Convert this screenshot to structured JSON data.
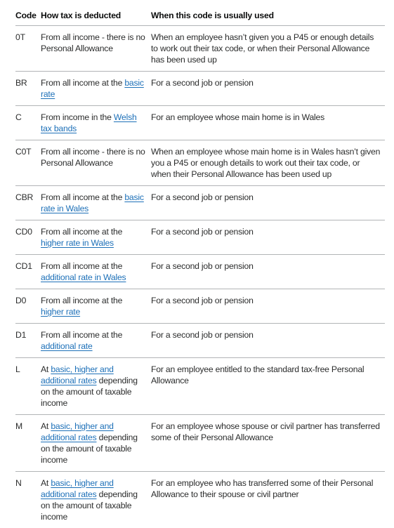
{
  "table": {
    "headers": [
      "Code",
      "How tax is deducted",
      "When this code is usually used"
    ],
    "link_color": "#1d70b8",
    "rows": [
      {
        "code": "0T",
        "how": [
          {
            "text": "From all income - there is no Personal Allowance"
          }
        ],
        "when": "When an employee hasn’t given you a P45 or enough details to work out their tax code, or when their Personal Allowance has been used up"
      },
      {
        "code": "BR",
        "how": [
          {
            "text": "From all income at the "
          },
          {
            "text": "basic rate",
            "link": true
          }
        ],
        "when": "For a second job or pension"
      },
      {
        "code": "C",
        "how": [
          {
            "text": "From income in the "
          },
          {
            "text": "Welsh tax bands",
            "link": true
          }
        ],
        "when": "For an employee whose main home is in Wales"
      },
      {
        "code": "C0T",
        "how": [
          {
            "text": "From all income - there is no Personal Allowance"
          }
        ],
        "when": "When an employee whose main home is in Wales hasn’t given you a P45 or enough details to work out their tax code, or when their Personal Allowance has been used up"
      },
      {
        "code": "CBR",
        "how": [
          {
            "text": "From all income at the "
          },
          {
            "text": "basic rate in Wales",
            "link": true
          }
        ],
        "when": "For a second job or pension"
      },
      {
        "code": "CD0",
        "how": [
          {
            "text": "From all income at the "
          },
          {
            "text": "higher rate in Wales",
            "link": true
          }
        ],
        "when": "For a second job or pension"
      },
      {
        "code": "CD1",
        "how": [
          {
            "text": "From all income at the "
          },
          {
            "text": "additional rate in Wales",
            "link": true
          }
        ],
        "when": "For a second job or pension"
      },
      {
        "code": "D0",
        "how": [
          {
            "text": "From all income at the "
          },
          {
            "text": "higher rate",
            "link": true
          }
        ],
        "when": "For a second job or pension"
      },
      {
        "code": "D1",
        "how": [
          {
            "text": "From all income at the "
          },
          {
            "text": "additional rate",
            "link": true
          }
        ],
        "when": "For a second job or pension"
      },
      {
        "code": "L",
        "how": [
          {
            "text": "At "
          },
          {
            "text": "basic, higher and additional rates",
            "link": true
          },
          {
            "text": " depending on the amount of taxable income"
          }
        ],
        "when": "For an employee entitled to the standard tax-free Personal Allowance"
      },
      {
        "code": "M",
        "how": [
          {
            "text": "At "
          },
          {
            "text": "basic, higher and additional rates",
            "link": true
          },
          {
            "text": " depending on the amount of taxable income"
          }
        ],
        "when": "For an employee whose spouse or civil partner has transferred some of their Personal Allowance"
      },
      {
        "code": "N",
        "how": [
          {
            "text": "At "
          },
          {
            "text": "basic, higher and additional rates",
            "link": true
          },
          {
            "text": " depending on the amount of taxable income"
          }
        ],
        "when": "For an employee who has transferred some of their Personal Allowance to their spouse or civil partner"
      }
    ]
  }
}
